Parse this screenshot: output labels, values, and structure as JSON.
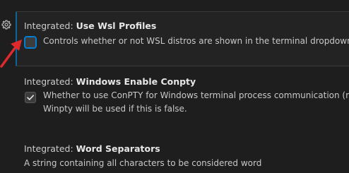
{
  "settings": [
    {
      "category": "Integrated: ",
      "name": "Use Wsl Profiles",
      "description": "Controls whether or not WSL distros are shown in the terminal dropdown",
      "checked": false
    },
    {
      "category": "Integrated: ",
      "name": "Windows Enable Conpty",
      "description_line1": "Whether to use ConPTY for Windows terminal process communication (requ",
      "description_line2": "Winpty will be used if this is false.",
      "checked": true
    },
    {
      "category": "Integrated: ",
      "name": "Word Separators",
      "description": "A string containing all characters to be considered word"
    }
  ],
  "icons": {
    "gear": "gear-icon",
    "check": "checkmark-icon",
    "arrow": "red-arrow-annotation"
  },
  "colors": {
    "background": "#1e1e1e",
    "focus": "#007fd4",
    "arrow": "#e0292b"
  }
}
